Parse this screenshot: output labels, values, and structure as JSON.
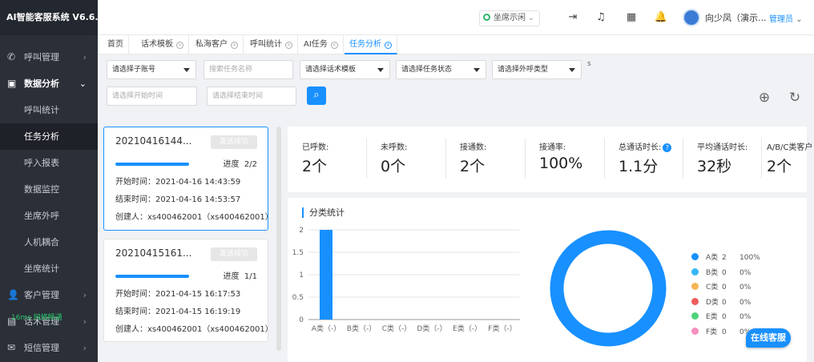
{
  "app": {
    "title": "AI智能客服系统 V6.6.0"
  },
  "sidebar": {
    "items": [
      {
        "label": "呼叫管理",
        "icon": "phone-icon",
        "type": "group"
      },
      {
        "label": "数据分析",
        "icon": "chart-icon",
        "type": "group-open"
      },
      {
        "label": "呼叫统计",
        "type": "sub"
      },
      {
        "label": "任务分析",
        "type": "sub-active"
      },
      {
        "label": "呼入报表",
        "type": "sub"
      },
      {
        "label": "数据监控",
        "type": "sub"
      },
      {
        "label": "坐席外呼",
        "type": "sub"
      },
      {
        "label": "人机耦合",
        "type": "sub"
      },
      {
        "label": "坐席统计",
        "type": "sub"
      },
      {
        "label": "客户管理",
        "icon": "user-icon",
        "type": "group"
      },
      {
        "label": "话术管理",
        "icon": "doc-icon",
        "type": "group"
      },
      {
        "label": "短信管理",
        "icon": "mail-icon",
        "type": "group"
      }
    ],
    "network_badge": "16ms 网络畅通"
  },
  "topbar": {
    "status_label": "坐席示闲",
    "user_name": "向少凤（演示...",
    "role": "管理员"
  },
  "tabs": [
    {
      "label": "首页",
      "closable": false
    },
    {
      "label": "话术模板",
      "closable": true
    },
    {
      "label": "私海客户",
      "closable": true
    },
    {
      "label": "呼叫统计",
      "closable": true
    },
    {
      "label": "AI任务",
      "closable": true
    },
    {
      "label": "任务分析",
      "closable": true,
      "active": true
    }
  ],
  "filters": {
    "sub_account": "请选择子账号",
    "task_name_placeholder": "搜索任务名称",
    "script_template": "请选择话术模板",
    "task_status": "请选择任务状态",
    "outbound_type": "请选择外呼类型",
    "start_time_placeholder": "请选择开始时间",
    "end_time_placeholder": "请选择结束时间",
    "stray_char": "s"
  },
  "tasks": [
    {
      "id": "20210416144...",
      "badge": "发送成功",
      "progress_label": "进度",
      "progress": "2/2",
      "progress_fraction": 1.0,
      "start": "开始时间：2021-04-16 14:43:59",
      "end": "结束时间：2021-04-16 14:53:57",
      "creator": "创建人：xs400462001（xs400462001）",
      "selected": true
    },
    {
      "id": "20210415161...",
      "badge": "发送成功",
      "progress_label": "进度",
      "progress": "1/1",
      "progress_fraction": 1.0,
      "start": "开始时间：2021-04-15 16:17:53",
      "end": "结束时间：2021-04-15 16:19:19",
      "creator": "创建人：xs400462001（xs400462001）",
      "selected": false
    }
  ],
  "stats": [
    {
      "label": "已呼数:",
      "value": "2个"
    },
    {
      "label": "未呼数:",
      "value": "0个"
    },
    {
      "label": "接通数:",
      "value": "2个"
    },
    {
      "label": "接通率:",
      "value": "100%"
    },
    {
      "label": "总通话时长:",
      "value": "1.1分",
      "help": "?"
    },
    {
      "label": "平均通话时长:",
      "value": "32秒"
    },
    {
      "label": "A/B/C类客户",
      "value": "2个"
    }
  ],
  "chart_panel": {
    "title": "分类统计"
  },
  "chart_data": [
    {
      "type": "bar",
      "categories": [
        "A类（-）",
        "B类（-）",
        "C类（-）",
        "D类（-）",
        "E类（-）",
        "F类（-）"
      ],
      "values": [
        2,
        0,
        0,
        0,
        0,
        0
      ],
      "ylim": [
        0,
        2
      ],
      "yticks": [
        "0",
        "0.5",
        "1",
        "1.5",
        "2"
      ],
      "color": "#1890ff",
      "grid": "horizontal"
    },
    {
      "type": "pie",
      "donut": true,
      "legend": [
        {
          "name": "A类",
          "value": 2,
          "pct": "100%",
          "color": "#1890ff"
        },
        {
          "name": "B类",
          "value": 0,
          "pct": "0%",
          "color": "#37b6f6"
        },
        {
          "name": "C类",
          "value": 0,
          "pct": "0%",
          "color": "#f5b556"
        },
        {
          "name": "D类",
          "value": 0,
          "pct": "0%",
          "color": "#ef5c5c"
        },
        {
          "name": "E类",
          "value": 0,
          "pct": "0%",
          "color": "#4fd37a"
        },
        {
          "name": "F类",
          "value": 0,
          "pct": "0%",
          "color": "#f58fc0"
        }
      ],
      "legend_position": "right"
    }
  ],
  "floating": {
    "online_service": "在线客服"
  }
}
